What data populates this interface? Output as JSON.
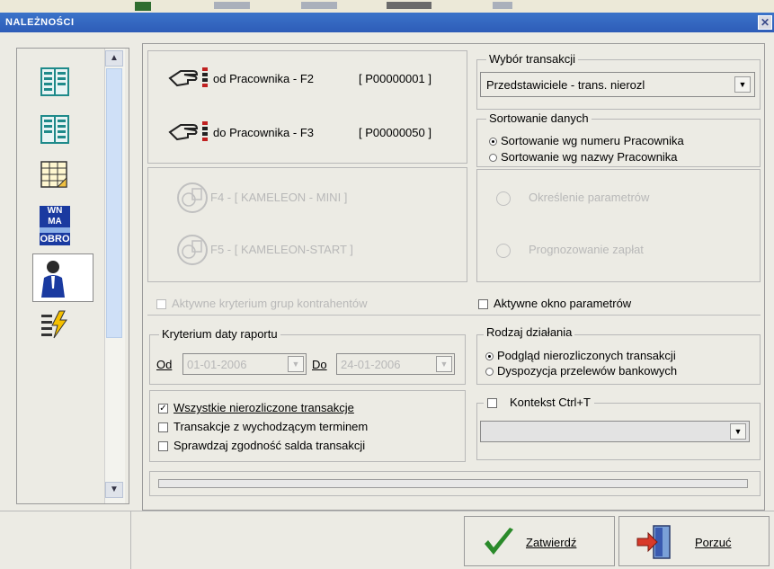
{
  "window": {
    "title": "NALEŻNOŚCI",
    "close_glyph": "✕"
  },
  "side_icons": [
    {
      "name": "list-view-icon"
    },
    {
      "name": "list-view-icon-2"
    },
    {
      "name": "table-grid-icon"
    },
    {
      "name": "balance-icon",
      "line1": "WN MA",
      "line2": "OBRO"
    },
    {
      "name": "employee-icon"
    },
    {
      "name": "lightning-list-icon"
    }
  ],
  "employee_range": {
    "from_label": "od Pracownika - F2",
    "from_code": "[ P00000001 ]",
    "to_label": "do Pracownika - F3",
    "to_code": "[ P00000050 ]"
  },
  "kameleon": {
    "mini": "F4 - [ KAMELEON - MINI ]",
    "start": "F5 - [ KAMELEON-START ]"
  },
  "transaction_choice": {
    "legend": "Wybór transakcji",
    "selected": "Przedstawiciele - trans. nierozl"
  },
  "sorting": {
    "legend": "Sortowanie danych",
    "options": [
      "Sortowanie wg numeru Pracownika",
      "Sortowanie wg nazwy Pracownika"
    ],
    "selected_index": 0
  },
  "params_buttons": {
    "define": "Określenie parametrów",
    "forecast": "Prognozowanie zapłat"
  },
  "checkboxes": {
    "active_groups": "Aktywne kryterium grup kontrahentów",
    "active_params": "Aktywne okno parametrów",
    "ctrl_t": "Kontekst Ctrl+T"
  },
  "date_criteria": {
    "legend": "Kryterium daty raportu",
    "from_label": "Od",
    "from_value": "01-01-2006",
    "to_label": "Do",
    "to_value": "24-01-2006"
  },
  "action_type": {
    "legend": "Rodzaj działania",
    "options": [
      "Podgląd nierozliczonych transakcji",
      "Dyspozycja przelewów bankowych"
    ],
    "selected_index": 0
  },
  "transaction_options": [
    {
      "label": "Wszystkie nierozliczone transakcje",
      "checked": true
    },
    {
      "label": "Transakcje z wychodzącym terminem",
      "checked": false
    },
    {
      "label": "Sprawdzaj zgodność salda transakcji",
      "checked": false
    }
  ],
  "buttons": {
    "confirm": "Zatwierdź",
    "cancel": "Porzuć"
  },
  "colors": {
    "title_bar": "#2e5cb8",
    "check_green": "#2a8a2a",
    "exit_red": "#d83a2a"
  }
}
